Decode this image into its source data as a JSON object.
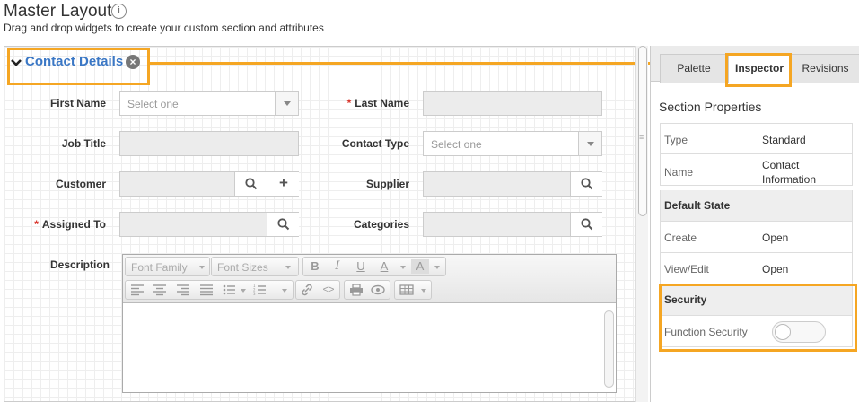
{
  "header": {
    "title": "Master Layout",
    "subtitle": "Drag and drop widgets to create your custom section and attributes",
    "info_glyph": "i"
  },
  "section": {
    "title": "Contact Details",
    "remove_glyph": "×"
  },
  "form": {
    "first_name": {
      "label": "First Name",
      "placeholder": "Select one"
    },
    "last_name": {
      "label": "Last Name",
      "required": "*"
    },
    "job_title": {
      "label": "Job Title"
    },
    "contact_type": {
      "label": "Contact Type",
      "placeholder": "Select one"
    },
    "customer": {
      "label": "Customer",
      "add_glyph": "+"
    },
    "supplier": {
      "label": "Supplier"
    },
    "assigned_to": {
      "label": "Assigned To",
      "required": "*"
    },
    "categories": {
      "label": "Categories"
    },
    "description": {
      "label": "Description"
    }
  },
  "editor": {
    "font_family": "Font Family",
    "font_sizes": "Font Sizes",
    "bold": "B",
    "italic": "I",
    "underline": "U",
    "font_color": "A",
    "bg_color": "A",
    "code": "<>"
  },
  "panel": {
    "tabs": [
      "Palette",
      "Inspector",
      "Revisions"
    ],
    "active_tab": "Inspector",
    "section_properties": "Section Properties",
    "rows": [
      {
        "key": "Type",
        "value": "Standard"
      },
      {
        "key": "Name",
        "value": "Contact Information"
      }
    ],
    "default_state": "Default State",
    "state_rows": [
      {
        "key": "Create",
        "value": "Open"
      },
      {
        "key": "View/Edit",
        "value": "Open"
      }
    ],
    "security": "Security",
    "function_security": "Function Security",
    "function_security_enabled": false
  },
  "colors": {
    "accent": "#3a77c5",
    "highlight": "#f5a623",
    "required": "#d9342b"
  }
}
